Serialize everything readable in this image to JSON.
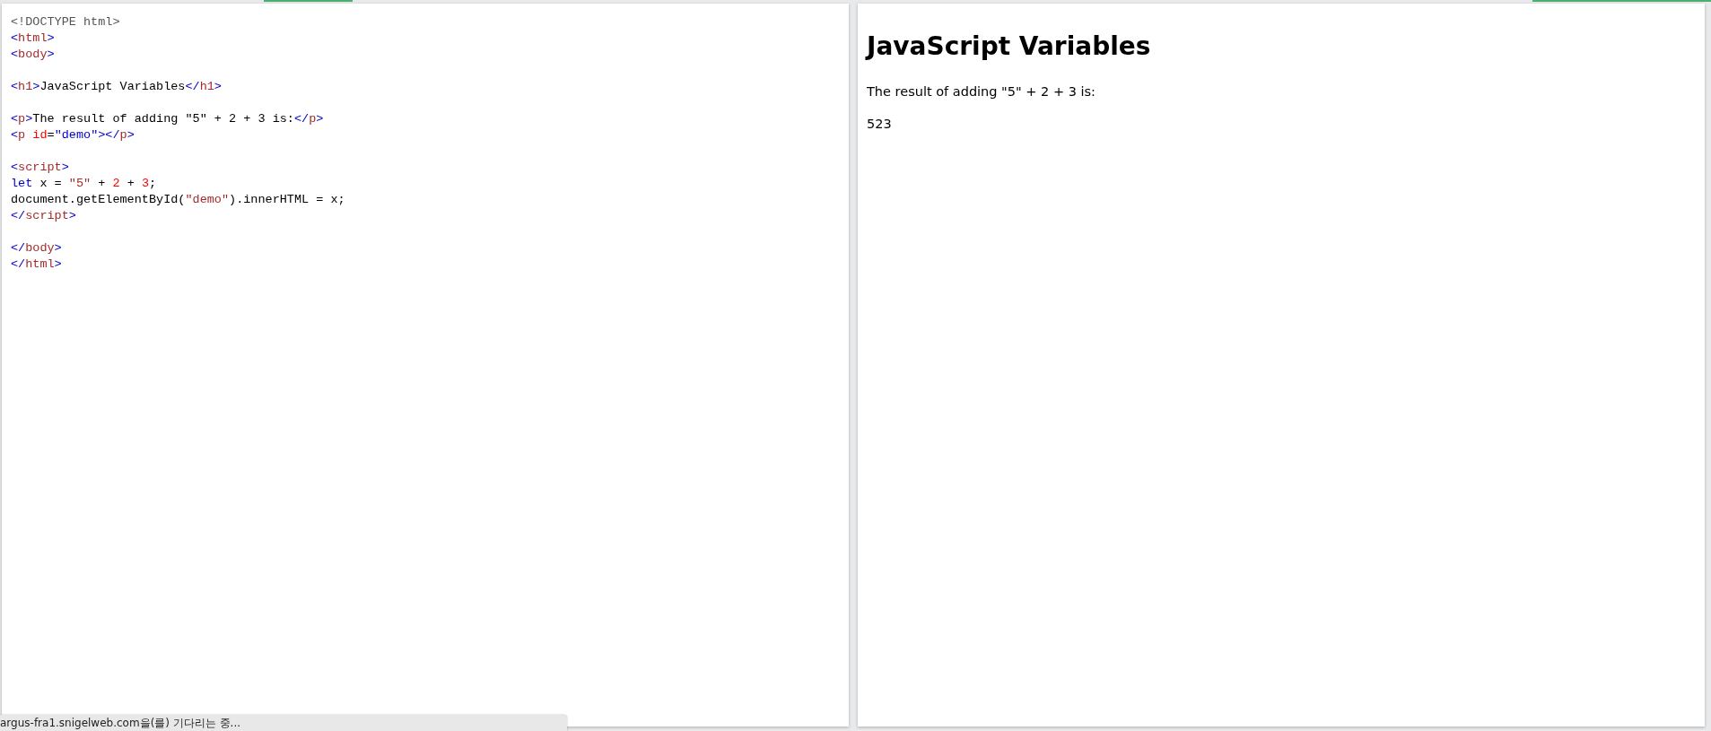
{
  "editor": {
    "blocks": [
      [
        [
          {
            "kind": "doctype",
            "t": "<!DOCTYPE html>"
          }
        ],
        [
          {
            "kind": "bracket",
            "t": "<"
          },
          {
            "kind": "tag",
            "t": "html"
          },
          {
            "kind": "bracket",
            "t": ">"
          }
        ],
        [
          {
            "kind": "bracket",
            "t": "<"
          },
          {
            "kind": "tag",
            "t": "body"
          },
          {
            "kind": "bracket",
            "t": ">"
          }
        ]
      ],
      [
        [
          {
            "kind": "bracket",
            "t": "<"
          },
          {
            "kind": "tag",
            "t": "h1"
          },
          {
            "kind": "bracket",
            "t": ">"
          },
          {
            "kind": "text",
            "t": "JavaScript Variables"
          },
          {
            "kind": "bracket",
            "t": "</"
          },
          {
            "kind": "tag",
            "t": "h1"
          },
          {
            "kind": "bracket",
            "t": ">"
          }
        ]
      ],
      [
        [
          {
            "kind": "bracket",
            "t": "<"
          },
          {
            "kind": "tag",
            "t": "p"
          },
          {
            "kind": "bracket",
            "t": ">"
          },
          {
            "kind": "text",
            "t": "The result of adding \"5\" + 2 + 3 is:"
          },
          {
            "kind": "bracket",
            "t": "</"
          },
          {
            "kind": "tag",
            "t": "p"
          },
          {
            "kind": "bracket",
            "t": ">"
          }
        ],
        [
          {
            "kind": "bracket",
            "t": "<"
          },
          {
            "kind": "tag",
            "t": "p"
          },
          {
            "kind": "attr",
            "t": " id"
          },
          {
            "kind": "text",
            "t": "="
          },
          {
            "kind": "value",
            "t": "\"demo\""
          },
          {
            "kind": "bracket",
            "t": "></"
          },
          {
            "kind": "tag",
            "t": "p"
          },
          {
            "kind": "bracket",
            "t": ">"
          }
        ]
      ],
      [
        [
          {
            "kind": "bracket",
            "t": "<"
          },
          {
            "kind": "tag",
            "t": "script"
          },
          {
            "kind": "bracket",
            "t": ">"
          }
        ],
        [
          {
            "kind": "keyword",
            "t": "let"
          },
          {
            "kind": "text",
            "t": " x = "
          },
          {
            "kind": "string",
            "t": "\"5\""
          },
          {
            "kind": "text",
            "t": " + "
          },
          {
            "kind": "number",
            "t": "2"
          },
          {
            "kind": "text",
            "t": " + "
          },
          {
            "kind": "number",
            "t": "3"
          },
          {
            "kind": "text",
            "t": ";"
          }
        ],
        [
          {
            "kind": "text",
            "t": "document.getElementById("
          },
          {
            "kind": "string",
            "t": "\"demo\""
          },
          {
            "kind": "text",
            "t": ").innerHTML = x;"
          }
        ],
        [
          {
            "kind": "bracket",
            "t": "</"
          },
          {
            "kind": "tag",
            "t": "script"
          },
          {
            "kind": "bracket",
            "t": ">"
          }
        ]
      ],
      [
        [
          {
            "kind": "bracket",
            "t": "</"
          },
          {
            "kind": "tag",
            "t": "body"
          },
          {
            "kind": "bracket",
            "t": ">"
          }
        ],
        [
          {
            "kind": "bracket",
            "t": "</"
          },
          {
            "kind": "tag",
            "t": "html"
          },
          {
            "kind": "bracket",
            "t": ">"
          }
        ]
      ]
    ]
  },
  "result": {
    "heading": "JavaScript Variables",
    "paragraphs": [
      "The result of adding \"5\" + 2 + 3 is:",
      "523"
    ]
  },
  "status_bar": {
    "text": "argus-fra1.snigelweb.com을(를) 기다리는 중..."
  }
}
